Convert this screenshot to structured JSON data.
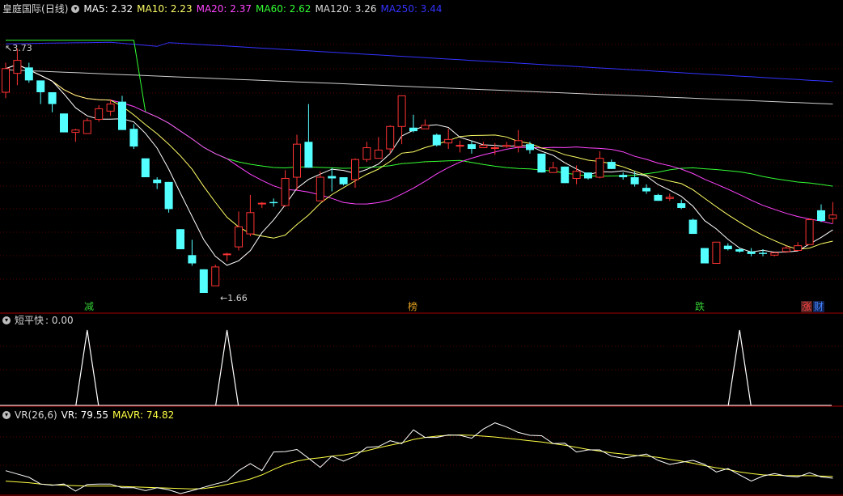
{
  "stock": {
    "name": "皇庭国际",
    "period": "(日线)"
  },
  "main_indicators": [
    {
      "label": "MA5:",
      "value": "2.32",
      "color": "#ffffff"
    },
    {
      "label": "MA10:",
      "value": "2.23",
      "color": "#ffff66"
    },
    {
      "label": "MA20:",
      "value": "2.37",
      "color": "#ff44ff"
    },
    {
      "label": "MA60:",
      "value": "2.62",
      "color": "#33ff33"
    },
    {
      "label": "MA120:",
      "value": "3.26",
      "color": "#dddddd"
    },
    {
      "label": "MA250:",
      "value": "3.44",
      "color": "#3333ff"
    }
  ],
  "price_high_label": "3.73",
  "price_low_label": "1.66",
  "event_tags": [
    {
      "text": "减",
      "color": "#33cc33"
    },
    {
      "text": "榜",
      "color": "#e0a020"
    },
    {
      "text": "跌",
      "color": "#33cc33"
    },
    {
      "text": "涨",
      "color": "#ff4444",
      "bg": "#552222"
    },
    {
      "text": "财",
      "color": "#4488ff",
      "bg": "#112255"
    }
  ],
  "panel2": {
    "title": "短平快",
    "value_text": ": 0.00",
    "signal_bars": [
      7,
      19,
      63
    ]
  },
  "panel3": {
    "title": "VR(26,6)",
    "vr_label": "VR: 79.55",
    "mavr_label": "MAVR: 74.82"
  },
  "colors": {
    "up": "#ff3333",
    "down": "#54ffff",
    "separator": "#aa0000",
    "grid": "#5a0000"
  },
  "chart_data": {
    "type": "candlestick",
    "candles": [
      [
        3.36,
        3.56,
        3.61,
        3.31
      ],
      [
        3.52,
        3.63,
        3.73,
        3.42
      ],
      [
        3.57,
        3.46,
        3.61,
        3.44
      ],
      [
        3.46,
        3.36,
        3.42,
        3.26
      ],
      [
        3.36,
        3.26,
        3.36,
        3.19
      ],
      [
        3.18,
        3.02,
        3.18,
        3.02
      ],
      [
        3.02,
        3.04,
        3.05,
        2.94
      ],
      [
        3.01,
        3.12,
        3.14,
        3.01
      ],
      [
        3.13,
        3.22,
        3.25,
        3.11
      ],
      [
        3.2,
        3.26,
        3.3,
        3.16
      ],
      [
        3.28,
        3.04,
        3.33,
        3.04
      ],
      [
        3.05,
        2.9,
        3.09,
        2.88
      ],
      [
        2.8,
        2.64,
        2.8,
        2.64
      ],
      [
        2.62,
        2.59,
        2.64,
        2.54
      ],
      [
        2.6,
        2.37,
        2.6,
        2.34
      ],
      [
        2.2,
        2.03,
        2.2,
        2.03
      ],
      [
        1.98,
        1.91,
        2.11,
        1.89
      ],
      [
        1.86,
        1.66,
        1.86,
        1.66
      ],
      [
        1.72,
        1.88,
        1.9,
        1.72
      ],
      [
        1.99,
        1.99,
        2.0,
        1.93
      ],
      [
        2.05,
        2.22,
        2.35,
        2.02
      ],
      [
        2.16,
        2.34,
        2.49,
        2.14
      ],
      [
        2.42,
        2.42,
        2.43,
        2.38
      ],
      [
        2.43,
        2.42,
        2.46,
        2.39
      ],
      [
        2.4,
        2.63,
        2.7,
        2.39
      ],
      [
        2.64,
        2.92,
        3.0,
        2.53
      ],
      [
        2.94,
        2.72,
        3.26,
        2.72
      ],
      [
        2.44,
        2.64,
        2.69,
        2.44
      ],
      [
        2.65,
        2.63,
        2.72,
        2.52
      ],
      [
        2.64,
        2.58,
        2.64,
        2.57
      ],
      [
        2.62,
        2.79,
        2.8,
        2.55
      ],
      [
        2.79,
        2.89,
        2.94,
        2.77
      ],
      [
        2.8,
        2.87,
        2.98,
        2.8
      ],
      [
        2.88,
        3.07,
        3.08,
        2.84
      ],
      [
        3.07,
        3.33,
        3.33,
        2.92
      ],
      [
        3.06,
        3.03,
        3.17,
        3.02
      ],
      [
        3.05,
        3.08,
        3.13,
        3.06
      ],
      [
        3.0,
        2.91,
        3.01,
        2.9
      ],
      [
        2.93,
        2.96,
        3.05,
        2.88
      ],
      [
        2.91,
        2.91,
        2.95,
        2.85
      ],
      [
        2.92,
        2.88,
        2.95,
        2.84
      ],
      [
        2.89,
        2.91,
        2.94,
        2.89
      ],
      [
        2.89,
        2.89,
        2.93,
        2.83
      ],
      [
        2.9,
        2.91,
        2.94,
        2.89
      ],
      [
        2.9,
        2.95,
        3.04,
        2.85
      ],
      [
        2.92,
        2.87,
        2.94,
        2.84
      ],
      [
        2.84,
        2.68,
        2.84,
        2.68
      ],
      [
        2.68,
        2.72,
        2.77,
        2.68
      ],
      [
        2.73,
        2.59,
        2.73,
        2.59
      ],
      [
        2.63,
        2.69,
        2.74,
        2.58
      ],
      [
        2.68,
        2.63,
        2.68,
        2.62
      ],
      [
        2.64,
        2.8,
        2.86,
        2.63
      ],
      [
        2.77,
        2.71,
        2.79,
        2.71
      ],
      [
        2.66,
        2.64,
        2.68,
        2.62
      ],
      [
        2.64,
        2.58,
        2.69,
        2.56
      ],
      [
        2.55,
        2.52,
        2.58,
        2.5
      ],
      [
        2.49,
        2.44,
        2.5,
        2.44
      ],
      [
        2.46,
        2.47,
        2.5,
        2.44
      ],
      [
        2.42,
        2.38,
        2.45,
        2.37
      ],
      [
        2.28,
        2.16,
        2.29,
        2.16
      ],
      [
        2.04,
        1.91,
        2.04,
        1.91
      ],
      [
        1.91,
        2.09,
        2.09,
        1.91
      ],
      [
        2.06,
        2.03,
        2.08,
        2.02
      ],
      [
        2.03,
        2.01,
        2.04,
        2.0
      ],
      [
        2.01,
        1.99,
        2.04,
        1.97
      ],
      [
        2.0,
        1.99,
        2.03,
        1.97
      ],
      [
        1.98,
        2.0,
        2.0,
        1.97
      ],
      [
        2.01,
        2.04,
        2.06,
        2.0
      ],
      [
        2.02,
        2.06,
        2.09,
        2.02
      ],
      [
        2.07,
        2.28,
        2.29,
        2.07
      ],
      [
        2.36,
        2.27,
        2.41,
        2.26
      ],
      [
        2.29,
        2.32,
        2.43,
        2.25
      ]
    ],
    "vr_series": [
      145,
      137,
      129,
      113,
      110,
      113,
      96,
      112,
      113,
      113,
      104,
      104,
      97,
      104,
      99,
      90,
      97,
      105,
      113,
      120,
      145,
      162,
      145,
      190,
      191,
      196,
      175,
      153,
      180,
      168,
      180,
      201,
      203,
      217,
      210,
      243,
      225,
      225,
      231,
      230,
      223,
      245,
      260,
      250,
      237,
      230,
      229,
      210,
      211,
      190,
      195,
      195,
      180,
      175,
      180,
      185,
      170,
      160,
      165,
      170,
      160,
      142,
      150,
      135,
      120,
      132,
      138,
      132,
      130,
      140,
      130,
      127
    ],
    "mavr_series": [
      120,
      118,
      116,
      113,
      111,
      110,
      109,
      108,
      108,
      108,
      107,
      106,
      105,
      104,
      103,
      102,
      101,
      102,
      106,
      112,
      118,
      125,
      135,
      148,
      160,
      168,
      173,
      176,
      180,
      183,
      188,
      193,
      200,
      206,
      212,
      220,
      225,
      228,
      230,
      231,
      230,
      228,
      226,
      223,
      220,
      217,
      214,
      210,
      206,
      201,
      196,
      192,
      188,
      185,
      182,
      180,
      177,
      172,
      168,
      163,
      157,
      152,
      148,
      142,
      138,
      135,
      134,
      133,
      133,
      133,
      132,
      131
    ]
  }
}
